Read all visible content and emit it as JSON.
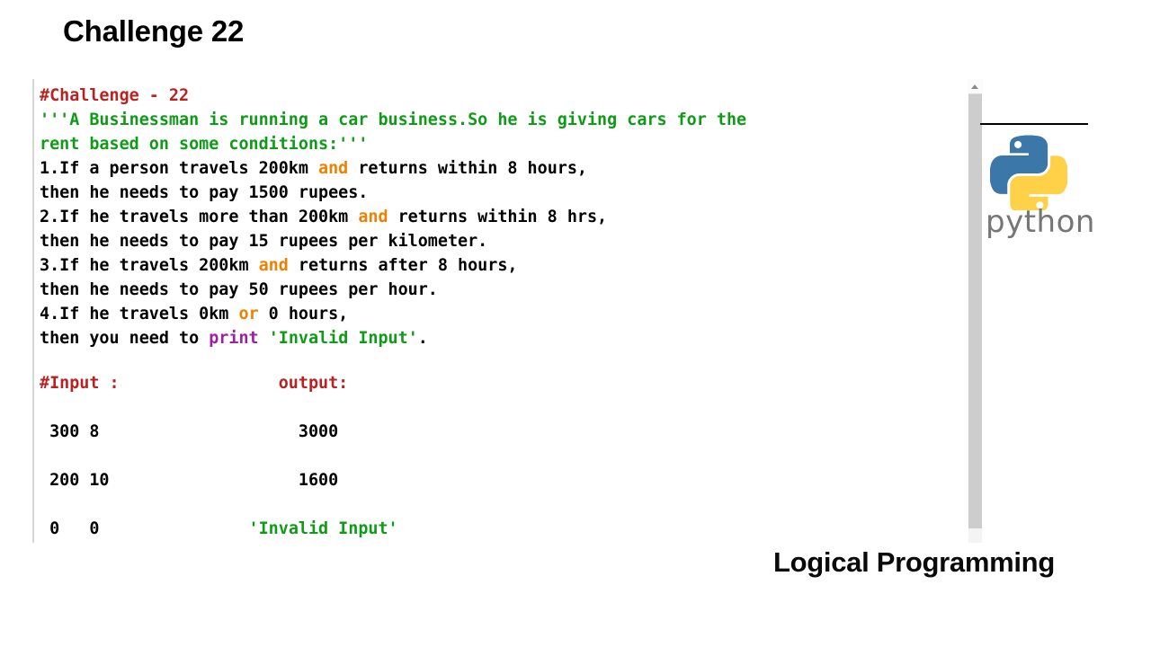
{
  "slide": {
    "title": "Challenge 22",
    "footer_brand": "Logical Programming"
  },
  "code_panel": {
    "lines": [
      [
        {
          "text": "#Challenge - 22",
          "type": "comment"
        }
      ],
      [
        {
          "text": "'''A Businessman is running a car business.So he is giving cars for the",
          "type": "string"
        }
      ],
      [
        {
          "text": "rent based on some conditions:'''",
          "type": "string"
        }
      ],
      [
        {
          "text": "1.If a person travels 200km ",
          "type": "plain"
        },
        {
          "text": "and",
          "type": "keyword"
        },
        {
          "text": " returns within 8 hours,",
          "type": "plain"
        }
      ],
      [
        {
          "text": "then he needs to pay 1500 rupees.",
          "type": "plain"
        }
      ],
      [
        {
          "text": "2.If he travels more than 200km ",
          "type": "plain"
        },
        {
          "text": "and",
          "type": "keyword"
        },
        {
          "text": " returns within 8 hrs,",
          "type": "plain"
        }
      ],
      [
        {
          "text": "then he needs to pay 15 rupees per kilometer.",
          "type": "plain"
        }
      ],
      [
        {
          "text": "3.If he travels 200km ",
          "type": "plain"
        },
        {
          "text": "and",
          "type": "keyword"
        },
        {
          "text": " returns after 8 hours,",
          "type": "plain"
        }
      ],
      [
        {
          "text": "then he needs to pay 50 rupees per hour.",
          "type": "plain"
        }
      ],
      [
        {
          "text": "4.If he travels 0km ",
          "type": "plain"
        },
        {
          "text": "or",
          "type": "keyword"
        },
        {
          "text": " 0 hours,",
          "type": "plain"
        }
      ],
      [
        {
          "text": "then you need to ",
          "type": "plain"
        },
        {
          "text": "print",
          "type": "builtin"
        },
        {
          "text": " ",
          "type": "plain"
        },
        {
          "text": "'Invalid Input'",
          "type": "string"
        },
        {
          "text": ".",
          "type": "plain"
        }
      ]
    ],
    "io_lines": [
      [
        {
          "text": "#Input :",
          "type": "comment"
        },
        {
          "text": "                ",
          "type": "plain"
        },
        {
          "text": "output:",
          "type": "comment"
        }
      ],
      [],
      [
        {
          "text": " 300 8",
          "type": "plain"
        },
        {
          "text": "                    ",
          "type": "plain"
        },
        {
          "text": "3000",
          "type": "plain"
        }
      ],
      [],
      [
        {
          "text": " 200 10",
          "type": "plain"
        },
        {
          "text": "                   ",
          "type": "plain"
        },
        {
          "text": "1600",
          "type": "plain"
        }
      ],
      [],
      [
        {
          "text": " 0   0",
          "type": "plain"
        },
        {
          "text": "               ",
          "type": "plain"
        },
        {
          "text": "'Invalid Input'",
          "type": "string"
        }
      ]
    ],
    "colors": {
      "comment": "#BA2121",
      "string": "#0F9B18",
      "keyword": "#F08000",
      "builtin": "#9E1FA0",
      "plain": "#000000",
      "panel_border": "#D6D6D6",
      "scrollbar_thumb": "#CDCDCD"
    }
  },
  "scrollbar": {
    "up_arrow_icon": "chevron-up-icon"
  },
  "python_logo": {
    "wordmark": "python",
    "blue": "#3C77A9",
    "yellow": "#FFD148",
    "wordmark_color": "#767676"
  }
}
